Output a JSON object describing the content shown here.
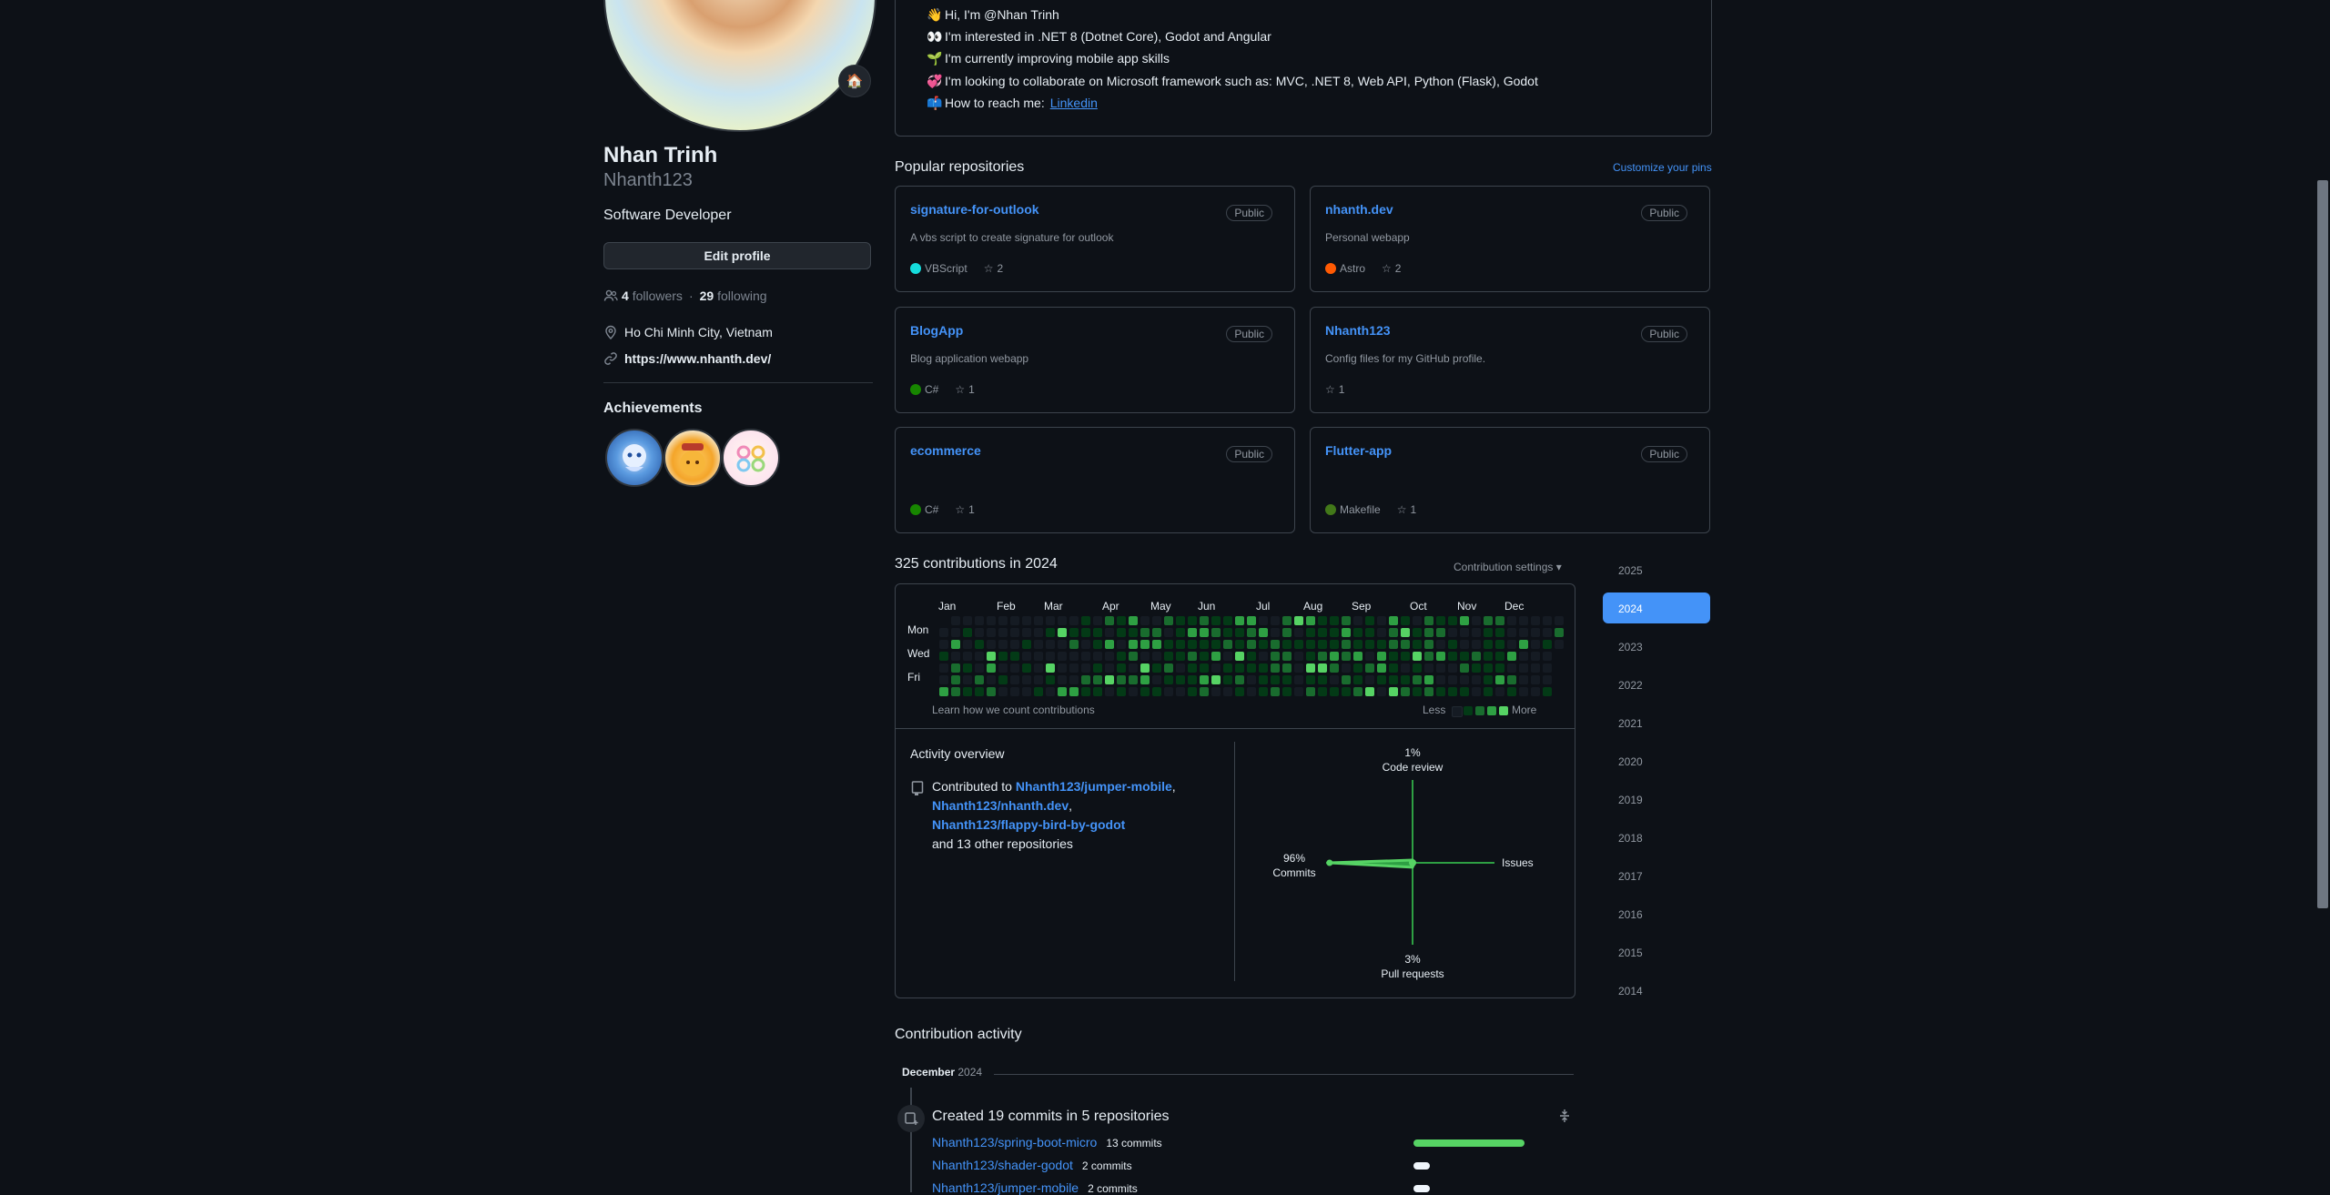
{
  "profile": {
    "name": "Nhan Trinh",
    "username": "Nhanth123",
    "bio": "Software Developer",
    "edit_button": "Edit profile",
    "followers_count": "4",
    "followers_label": "followers",
    "separator": "·",
    "following_count": "29",
    "following_label": "following",
    "location": "Ho Chi Minh City, Vietnam",
    "website": "https://www.nhanth.dev/",
    "achievements_title": "Achievements",
    "status_emoji": "🏠"
  },
  "readme": {
    "lines": [
      {
        "emoji": "👋",
        "text": "Hi, I'm @Nhan Trinh"
      },
      {
        "emoji": "👀",
        "text": "I'm interested in .NET 8 (Dotnet Core), Godot and Angular"
      },
      {
        "emoji": "🌱",
        "text": "I'm currently improving mobile app skills"
      },
      {
        "emoji": "💞️",
        "text": "I'm looking to collaborate on Microsoft framework such as: MVC, .NET 8, Web API, Python (Flask), Godot"
      },
      {
        "emoji": "📫",
        "text": "How to reach me:",
        "link": "Linkedin"
      }
    ]
  },
  "popular": {
    "title": "Popular repositories",
    "customize": "Customize your pins",
    "repos": [
      {
        "name": "signature-for-outlook",
        "visibility": "Public",
        "description": "A vbs script to create signature for outlook",
        "language": "VBScript",
        "lang_color": "#15dcdc",
        "stars": "2"
      },
      {
        "name": "nhanth.dev",
        "visibility": "Public",
        "description": "Personal webapp",
        "language": "Astro",
        "lang_color": "#ff5a03",
        "stars": "2"
      },
      {
        "name": "BlogApp",
        "visibility": "Public",
        "description": "Blog application webapp",
        "language": "C#",
        "lang_color": "#178600",
        "stars": "1"
      },
      {
        "name": "Nhanth123",
        "visibility": "Public",
        "description": "Config files for my GitHub profile.",
        "language": "",
        "lang_color": "",
        "stars": "1"
      },
      {
        "name": "ecommerce",
        "visibility": "Public",
        "description": "",
        "language": "C#",
        "lang_color": "#178600",
        "stars": "1"
      },
      {
        "name": "Flutter-app",
        "visibility": "Public",
        "description": "",
        "language": "Makefile",
        "lang_color": "#427819",
        "stars": "1"
      }
    ]
  },
  "contributions": {
    "title": "325 contributions in 2024",
    "settings": "Contribution settings",
    "months": [
      "Jan",
      "Feb",
      "Mar",
      "Apr",
      "May",
      "Jun",
      "Jul",
      "Aug",
      "Sep",
      "Oct",
      "Nov",
      "Dec"
    ],
    "days": [
      "Mon",
      "Wed",
      "Fri"
    ],
    "learn": "Learn how we count contributions",
    "less": "Less",
    "more": "More",
    "colors": [
      "#151b23",
      "#033a16",
      "#196c2e",
      "#2ea043",
      "#56d364"
    ]
  },
  "activity": {
    "title": "Activity overview",
    "contributed_to": "Contributed to",
    "repo1": "Nhanth123/jumper-mobile",
    "repo2": "Nhanth123/nhanth.dev",
    "repo3": "Nhanth123/flappy-bird-by-godot",
    "others": "and 13 other repositories",
    "radar": {
      "code_review_pct": "1%",
      "code_review_label": "Code review",
      "issues_label": "Issues",
      "pr_pct": "3%",
      "pr_label": "Pull requests",
      "commits_pct": "96%",
      "commits_label": "Commits",
      "commits_value": 96,
      "code_review_value": 1,
      "pr_value": 3,
      "issues_value": 0
    }
  },
  "years": [
    "2025",
    "2024",
    "2023",
    "2022",
    "2021",
    "2020",
    "2019",
    "2018",
    "2017",
    "2016",
    "2015",
    "2014"
  ],
  "selected_year": "2024",
  "contribution_activity": {
    "title": "Contribution activity",
    "month": "December",
    "year": "2024",
    "created": "Created 19 commits in 5 repositories",
    "rows": [
      {
        "repo": "Nhanth123/spring-boot-micro",
        "count": "13 commits",
        "fraction": 1.0
      },
      {
        "repo": "Nhanth123/shader-godot",
        "count": "2 commits",
        "fraction": 0.15
      },
      {
        "repo": "Nhanth123/jumper-mobile",
        "count": "2 commits",
        "fraction": 0.15
      }
    ]
  }
}
